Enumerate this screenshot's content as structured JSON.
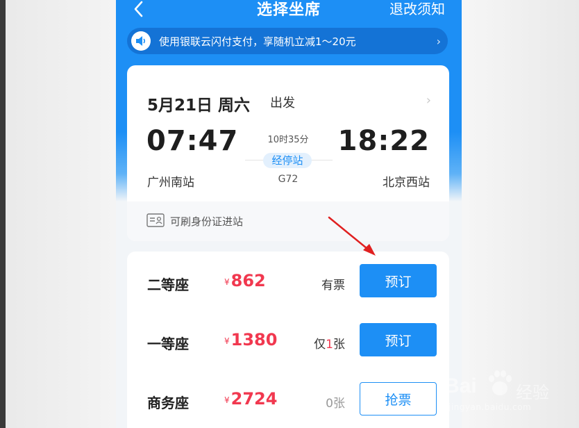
{
  "header": {
    "title": "选择坐席",
    "refund_rules": "退改须知"
  },
  "promo": {
    "text": "使用银联云闪付支付，享随机立减1～20元"
  },
  "trip": {
    "date": "5月21日 周六",
    "depart_label": "出发",
    "depart_time": "07:47",
    "arrive_time": "18:22",
    "duration": "10时35分",
    "stops_label": "经停站",
    "train_number": "G72",
    "depart_station": "广州南站",
    "arrive_station": "北京西站",
    "id_card_note": "可刷身份证进站"
  },
  "seats": [
    {
      "name": "二等座",
      "currency": "¥",
      "price": "862",
      "availability_prefix": "",
      "availability_num": "",
      "availability_suffix": "有票",
      "button": "预订"
    },
    {
      "name": "一等座",
      "currency": "¥",
      "price": "1380",
      "availability_prefix": "仅",
      "availability_num": "1",
      "availability_suffix": "张",
      "button": "预订"
    },
    {
      "name": "商务座",
      "currency": "¥",
      "price": "2724",
      "availability_prefix": "",
      "availability_num": "",
      "availability_suffix": "0张",
      "button": "抢票"
    }
  ],
  "watermark": {
    "brand_left": "Bai",
    "brand_right": "经验",
    "url": "jingyan.baidu.com"
  },
  "colors": {
    "primary": "#1d8ff5",
    "price": "#f1384f",
    "annotation_arrow": "#e02020"
  }
}
